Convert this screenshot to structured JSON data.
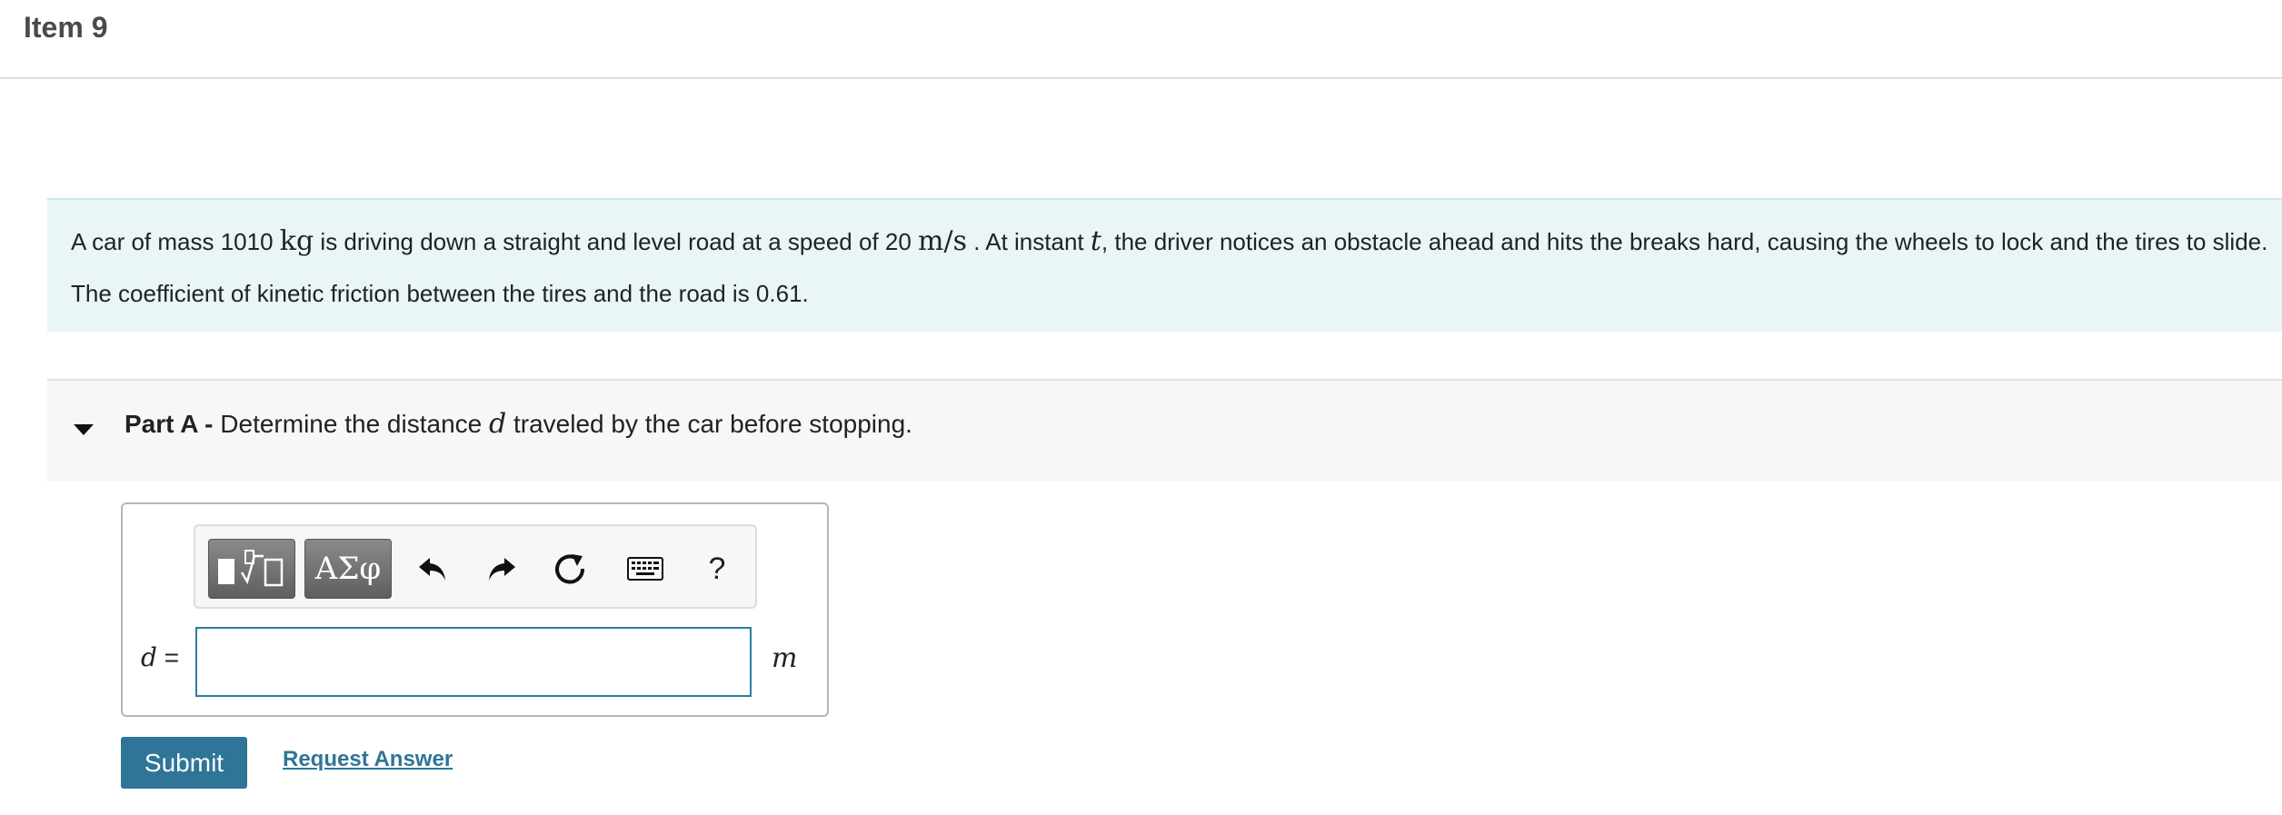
{
  "item": {
    "title": "Item 9"
  },
  "problem": {
    "line1": {
      "t1": "A car of mass 1010 ",
      "m1": "kg",
      "t2": " is driving down a straight and level road at a speed of 20 ",
      "m2": "m/s",
      "t3": " . At instant ",
      "m3": "t",
      "t4": ", the driver notices an obstacle ahead and hits the breaks hard, causing the wheels to lock and the tires to slide."
    },
    "line2": "The coefficient of kinetic friction between the tires and the road is 0.61."
  },
  "part": {
    "label": "Part A - ",
    "t1": "Determine the distance ",
    "var": "d",
    "t2": " traveled by the car before stopping."
  },
  "toolbar": {
    "symbols_label": "ΑΣφ",
    "help_label": "?",
    "icons": [
      "templates-icon",
      "undo-icon",
      "redo-icon",
      "reset-icon",
      "keyboard-icon"
    ]
  },
  "answer": {
    "variable": "d",
    "equals": " =",
    "value": "",
    "unit": "m"
  },
  "actions": {
    "submit_label": "Submit",
    "request_label": "Request Answer"
  },
  "colors": {
    "problem_bg": "#e9f6f5",
    "submit_bg": "#2f7597",
    "input_border": "#2a7ea1"
  }
}
